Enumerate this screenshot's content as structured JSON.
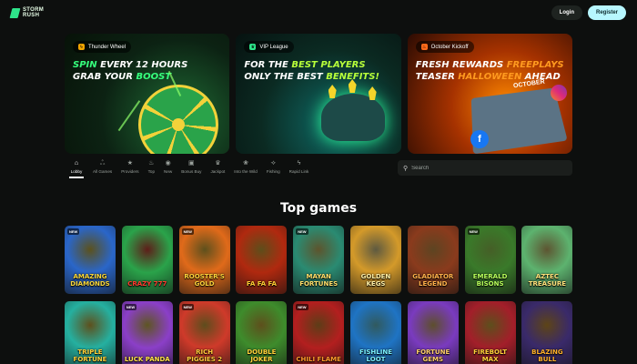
{
  "header": {
    "logo_line1": "STORM",
    "logo_line2": "RUSH",
    "login_label": "Login",
    "register_label": "Register"
  },
  "banners": [
    {
      "tag": "Thunder Wheel",
      "tag_icon": "lightning-icon",
      "line1_pre": "SPIN",
      "line1_post": " EVERY 12 HOURS",
      "line2_pre": "GRAB YOUR ",
      "line2_hl": "BOOST"
    },
    {
      "tag": "VIP League",
      "tag_icon": "crown-icon",
      "line1_pre": "FOR THE ",
      "line1_hl": "BEST PLAYERS",
      "line2_pre": "ONLY THE BEST ",
      "line2_hl": "BENEFITS!"
    },
    {
      "tag": "October Kickoff",
      "tag_icon": "flame-icon",
      "line1_pre": "FRESH REWARDS ",
      "line1_hl": "FREEPLAYS",
      "line2_pre": "TEASER ",
      "line2_hl": "HALLOWEEN",
      "line2_post": " AHEAD",
      "calendar_title": "OCTOBER"
    }
  ],
  "nav": [
    {
      "label": "Lobby",
      "icon": "home-icon",
      "glyph": "⌂",
      "active": true
    },
    {
      "label": "All Games",
      "icon": "cherries-icon",
      "glyph": "ஃ"
    },
    {
      "label": "Providers",
      "icon": "star-icon",
      "glyph": "★"
    },
    {
      "label": "Top",
      "icon": "fire-icon",
      "glyph": "♨"
    },
    {
      "label": "New",
      "icon": "new-icon",
      "glyph": "◉"
    },
    {
      "label": "Bonus Buy",
      "icon": "shopping-bag-icon",
      "glyph": "▣"
    },
    {
      "label": "Jackpot",
      "icon": "trophy-icon",
      "glyph": "♛"
    },
    {
      "label": "Into the Wild",
      "icon": "paw-icon",
      "glyph": "❀"
    },
    {
      "label": "Fishing",
      "icon": "fish-icon",
      "glyph": "⟢"
    },
    {
      "label": "Rapid Link",
      "icon": "bolt-icon",
      "glyph": "ϟ"
    }
  ],
  "search": {
    "placeholder": "Search"
  },
  "section_title": "Top games",
  "games": [
    {
      "title": "Amazing Diamonds",
      "bg": "#2a66c9",
      "accent": "#f8d63a",
      "new": true
    },
    {
      "title": "Crazy 777",
      "bg": "#2aa34a",
      "accent": "#ff3b2f",
      "new": false
    },
    {
      "title": "Rooster's Gold",
      "bg": "#e06a1a",
      "accent": "#ffd23a",
      "new": true
    },
    {
      "title": "Fa Fa Fa",
      "bg": "#b0290f",
      "accent": "#ffcc33",
      "new": false
    },
    {
      "title": "Mayan Fortunes",
      "bg": "#2a8b72",
      "accent": "#ffdf6a",
      "new": true
    },
    {
      "title": "Golden Kegs",
      "bg": "#d49a2a",
      "accent": "#fff0a6",
      "new": false
    },
    {
      "title": "Gladiator Legend",
      "bg": "#8a3b1d",
      "accent": "#ffb04a",
      "new": false
    },
    {
      "title": "Emerald Bisons",
      "bg": "#3a7a2a",
      "accent": "#b7ff5a",
      "new": true
    },
    {
      "title": "Aztec Treasure",
      "bg": "#5db36f",
      "accent": "#ffe27a",
      "new": false
    },
    {
      "title": "Triple Fortune",
      "bg": "#25b0a0",
      "accent": "#ffd23a",
      "new": false
    },
    {
      "title": "Luck Panda",
      "bg": "#8b3fc8",
      "accent": "#ffe34a",
      "new": true
    },
    {
      "title": "Rich Piggies 2",
      "bg": "#cf3a2a",
      "accent": "#ffc83a",
      "new": true
    },
    {
      "title": "Double Joker",
      "bg": "#3e8c2c",
      "accent": "#ffd23a",
      "new": false
    },
    {
      "title": "Chili Flame",
      "bg": "#b31f1f",
      "accent": "#ff9a2a",
      "new": true
    },
    {
      "title": "Fishline Loot",
      "bg": "#1f74c4",
      "accent": "#7af0ff",
      "new": false
    },
    {
      "title": "Fortune Gems",
      "bg": "#7a3bbf",
      "accent": "#ffcf6a",
      "new": false
    },
    {
      "title": "Firebolt Max",
      "bg": "#a31f2a",
      "accent": "#ffcf3a",
      "new": false
    },
    {
      "title": "Blazing Bull",
      "bg": "#3a2a6a",
      "accent": "#ffb02a",
      "new": false
    }
  ]
}
